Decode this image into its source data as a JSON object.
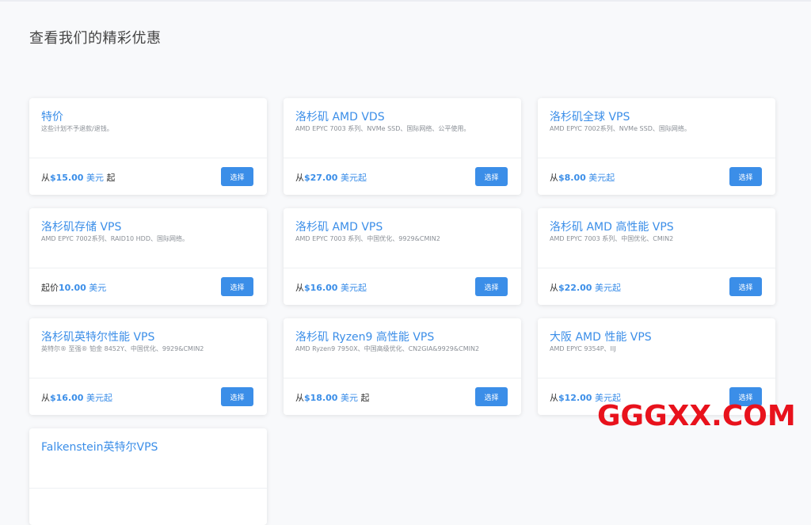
{
  "page": {
    "title": "查看我们的精彩优惠"
  },
  "cards": [
    {
      "title": "特价",
      "desc": "这些计划不予退款/退钱。",
      "price_prefix": "从",
      "price_amount": "$15.00",
      "price_unit": "美元",
      "price_suffix": "起",
      "button": "选择"
    },
    {
      "title": "洛杉矶 AMD VDS",
      "desc": "AMD EPYC 7003 系列、NVMe SSD、国际网络、公平使用。",
      "price_prefix": "从",
      "price_amount": "$27.00",
      "price_unit": "美元起",
      "price_suffix": "",
      "button": "选择"
    },
    {
      "title": "洛杉矶全球 VPS",
      "desc": "AMD EPYC 7002系列、NVMe SSD、国际网络。",
      "price_prefix": "从",
      "price_amount": "$8.00",
      "price_unit": "美元起",
      "price_suffix": "",
      "button": "选择"
    },
    {
      "title": "洛杉矶存储 VPS",
      "desc": "AMD EPYC 7002系列、RAID10 HDD、国际网络。",
      "price_prefix": "起价",
      "price_amount": "10.00",
      "price_unit": "美元",
      "price_suffix": "",
      "button": "选择"
    },
    {
      "title": "洛杉矶 AMD VPS",
      "desc": "AMD EPYC 7003 系列、中国优化、9929&CMIN2",
      "price_prefix": "从",
      "price_amount": "$16.00",
      "price_unit": "美元起",
      "price_suffix": "",
      "button": "选择"
    },
    {
      "title": "洛杉矶 AMD 高性能 VPS",
      "desc": "AMD EPYC 7003 系列、中国优化、CMIN2",
      "price_prefix": "从",
      "price_amount": "$22.00",
      "price_unit": "美元起",
      "price_suffix": "",
      "button": "选择"
    },
    {
      "title": "洛杉矶英特尔性能 VPS",
      "desc": "英特尔® 至强® 铂金 8452Y、中国优化、9929&CMIN2",
      "price_prefix": "从",
      "price_amount": "$16.00",
      "price_unit": "美元起",
      "price_suffix": "",
      "button": "选择"
    },
    {
      "title": "洛杉矶 Ryzen9 高性能 VPS",
      "desc": "AMD Ryzen9 7950X、中国高级优化、CN2GIA&9929&CMIN2",
      "price_prefix": "从",
      "price_amount": "$18.00",
      "price_unit": "美元",
      "price_suffix": "起",
      "button": "选择"
    },
    {
      "title": "大阪 AMD 性能 VPS",
      "desc": "AMD EPYC 9354P、IIJ",
      "price_prefix": "从",
      "price_amount": "$12.00",
      "price_unit": "美元起",
      "price_suffix": "",
      "button": "选择"
    },
    {
      "title": "Falkenstein英特尔VPS",
      "desc": "",
      "price_prefix": "",
      "price_amount": "",
      "price_unit": "",
      "price_suffix": "",
      "button": ""
    }
  ],
  "watermark": "GGGXX.COM",
  "colors": {
    "accent": "#3b8ee8",
    "watermark": "#e8121c",
    "background": "#f8f9fb"
  }
}
